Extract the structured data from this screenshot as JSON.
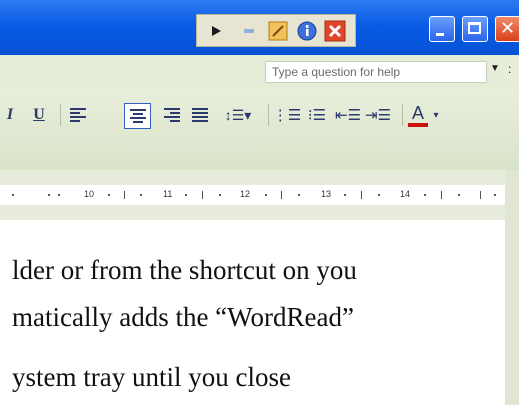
{
  "floating_toolbar": {
    "buttons": [
      "play-icon",
      "stop-icon",
      "wand-icon",
      "info-icon",
      "close-icon"
    ]
  },
  "window_controls": [
    "minimize",
    "maximize",
    "close"
  ],
  "help": {
    "placeholder": "Type a question for help"
  },
  "toolbar": {
    "buttons": [
      "italic",
      "underline",
      "align-left",
      "align-center",
      "align-right",
      "justify",
      "line-spacing",
      "numbering",
      "bullets",
      "decrease-indent",
      "increase-indent",
      "font-color"
    ],
    "italic_label": "I",
    "underline_label": "U",
    "font_color_label": "A"
  },
  "ruler": {
    "marks": [
      "10",
      "11",
      "12",
      "13",
      "14"
    ]
  },
  "document": {
    "lines": [
      "lder or from the shortcut on you",
      "matically adds the “WordRead”",
      "ystem tray until you close"
    ]
  },
  "colors": {
    "title_bar": "#0a5ce6",
    "toolbar_bg": "#e6edd9",
    "close_red": "#d8401a"
  }
}
